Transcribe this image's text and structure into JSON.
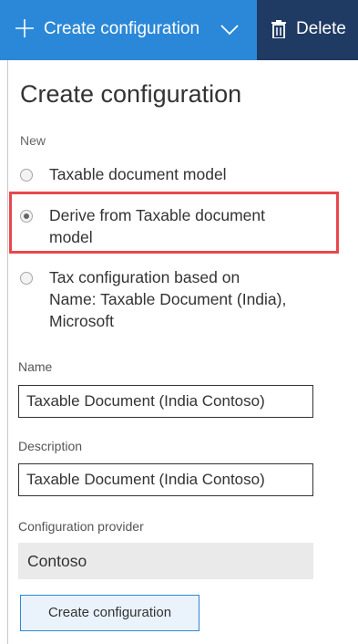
{
  "toolbar": {
    "create_label": "Create configuration",
    "delete_label": "Delete",
    "create_bg": "#2b88d8",
    "delete_bg": "#1f3a63"
  },
  "panel": {
    "title": "Create configuration",
    "new_label": "New",
    "options": [
      {
        "label": "Taxable document model",
        "selected": false
      },
      {
        "label_line1": "Derive from Taxable document",
        "label_line2": "model",
        "selected": true
      },
      {
        "label_line1": "Tax configuration based on",
        "label_line2": "Name: Taxable Document (India),",
        "label_line3": "Microsoft",
        "selected": false
      }
    ],
    "name_label": "Name",
    "name_value": "Taxable Document (India Contoso)",
    "description_label": "Description",
    "description_value": "Taxable Document (India Contoso)",
    "provider_label": "Configuration provider",
    "provider_value": "Contoso",
    "submit_label": "Create configuration",
    "highlight_color": "#e8484b"
  },
  "icons": [
    "plus-icon",
    "chevron-down-icon",
    "trash-icon"
  ]
}
